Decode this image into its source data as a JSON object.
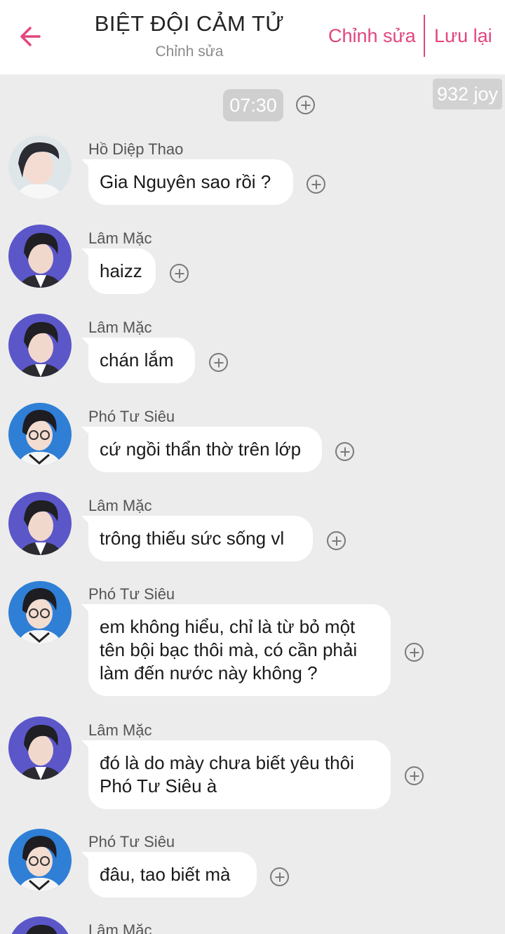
{
  "header": {
    "title": "BIỆT ĐỘI CẢM TỬ",
    "subtitle": "Chỉnh sửa",
    "edit_label": "Chỉnh sửa",
    "save_label": "Lưu lại",
    "back_icon": "arrow-left-icon",
    "accent_color": "#e2457f"
  },
  "joy_badge": "932 joy",
  "time_badge": "07:30",
  "messages": [
    {
      "sender": "Hồ Diệp Thao",
      "lines": [
        "Gia Nguyên sao rồi ?"
      ]
    },
    {
      "sender": "Lâm Mặc",
      "lines": [
        "haizz"
      ]
    },
    {
      "sender": "Lâm Mặc",
      "lines": [
        "chán lắm"
      ]
    },
    {
      "sender": "Phó Tư Siêu",
      "lines": [
        "cứ ngồi thẩn thờ trên lớp"
      ]
    },
    {
      "sender": "Lâm Mặc",
      "lines": [
        "trông thiếu sức sống vl"
      ]
    },
    {
      "sender": "Phó Tư Siêu",
      "lines": [
        "em không hiểu, chỉ là từ bỏ một",
        "tên bội bạc thôi mà, có cần phải",
        "làm đến nước này không ?"
      ]
    },
    {
      "sender": "Lâm Mặc",
      "lines": [
        "đó là do mày chưa biết yêu thôi",
        "Phó Tư Siêu à"
      ]
    },
    {
      "sender": "Phó Tư Siêu",
      "lines": [
        "đâu, tao biết mà"
      ]
    },
    {
      "sender": "Lâm Mặc",
      "lines": []
    }
  ]
}
